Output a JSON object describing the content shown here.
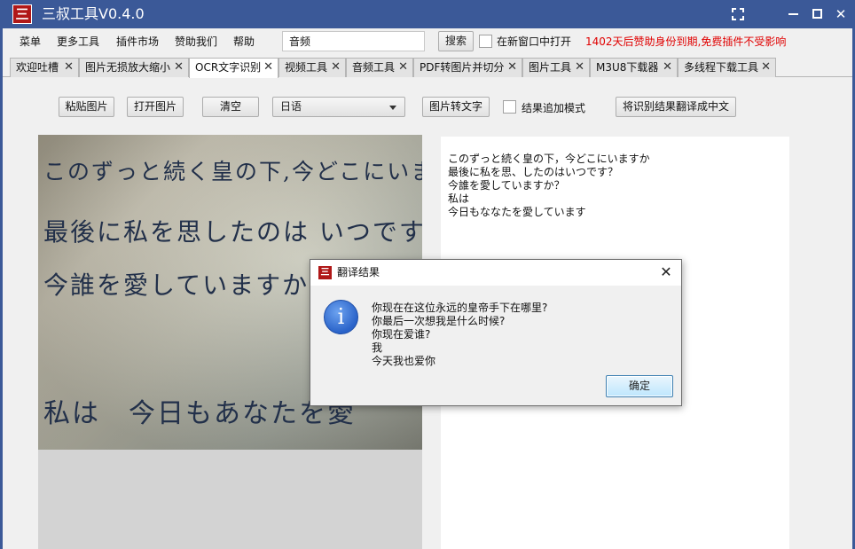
{
  "app": {
    "logo_glyph": "三",
    "title": "三叔工具V0.4.0",
    "accent_color": "#3b5998",
    "window_controls": [
      "fullscreen-icon",
      "minimize-icon",
      "maximize-icon",
      "close-icon"
    ],
    "close_glyph": "✕"
  },
  "menubar": {
    "items": [
      "菜单",
      "更多工具",
      "插件市场",
      "赞助我们",
      "帮助"
    ],
    "search_value": "音频",
    "search_button": "搜索",
    "new_window_label": "在新窗口中打开",
    "new_window_checked": false,
    "notice": "1402天后赞助身份到期,免费插件不受影响",
    "notice_color": "#e00000"
  },
  "tabs": {
    "close_glyph": "✕",
    "items": [
      {
        "label": "欢迎吐槽",
        "active": false
      },
      {
        "label": "图片无损放大缩小",
        "active": false
      },
      {
        "label": "OCR文字识别",
        "active": true
      },
      {
        "label": "视频工具",
        "active": false
      },
      {
        "label": "音频工具",
        "active": false
      },
      {
        "label": "PDF转图片并切分",
        "active": false
      },
      {
        "label": "图片工具",
        "active": false
      },
      {
        "label": "M3U8下载器",
        "active": false
      },
      {
        "label": "多线程下载工具",
        "active": false
      }
    ]
  },
  "toolbar": {
    "paste_image": "粘贴图片",
    "open_image": "打开图片",
    "clear": "清空",
    "language": "日语",
    "image_to_text": "图片转文字",
    "append_mode_label": "结果追加模式",
    "append_mode_checked": false,
    "translate": "将识别结果翻译成中文"
  },
  "image": {
    "handwriting": [
      "このずっと続く皇の下,今どこにいますか?",
      "最後に私を思したのは いつですか?",
      "今誰を愛していますか?",
      "私は　今日もあなたを愛"
    ]
  },
  "ocr_result": {
    "lines": [
      "このずっと続く皇の下，今どこにいますか",
      "最後に私を思、したのはいつです？",
      "今誰を愛していますか？",
      "私は",
      "今日もななたを愛しています"
    ]
  },
  "dialog": {
    "logo_glyph": "三",
    "title": "翻译结果",
    "close_glyph": "✕",
    "info_glyph": "i",
    "lines": [
      "你现在在这位永远的皇帝手下在哪里?",
      "你最后一次想我是什么时候?",
      "你现在爱谁?",
      "我",
      "今天我也爱你"
    ],
    "ok": "确定"
  }
}
